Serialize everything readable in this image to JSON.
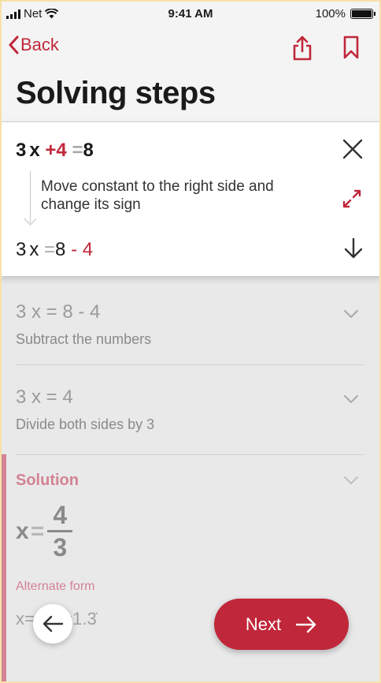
{
  "status_bar": {
    "carrier": "Net",
    "time": "9:41 AM",
    "battery": "100%"
  },
  "nav": {
    "back_label": "Back",
    "title": "Solving steps"
  },
  "current_step": {
    "equation_before": {
      "a": "3",
      "v": "x",
      "plus": "+",
      "c": "4",
      "eq": "=",
      "r": "8"
    },
    "instruction": "Move constant to the right side and change its sign",
    "equation_after": {
      "a": "3",
      "v": "x",
      "eq": "=",
      "r": "8",
      "minus": "-",
      "c": "4"
    }
  },
  "steps": [
    {
      "equation": "3 x = 8 - 4",
      "description": "Subtract the numbers"
    },
    {
      "equation": "3 x = 4",
      "description": "Divide both sides by 3"
    }
  ],
  "solution": {
    "label": "Solution",
    "variable": "x",
    "eq": "=",
    "numerator": "4",
    "denominator": "3",
    "alternate_label": "Alternate form",
    "alternate_forms": "x=1,  x=1.3̇"
  },
  "buttons": {
    "next_label": "Next"
  },
  "colors": {
    "accent": "#c0273a",
    "solution": "#d38393",
    "background": "#e9e9ea"
  }
}
